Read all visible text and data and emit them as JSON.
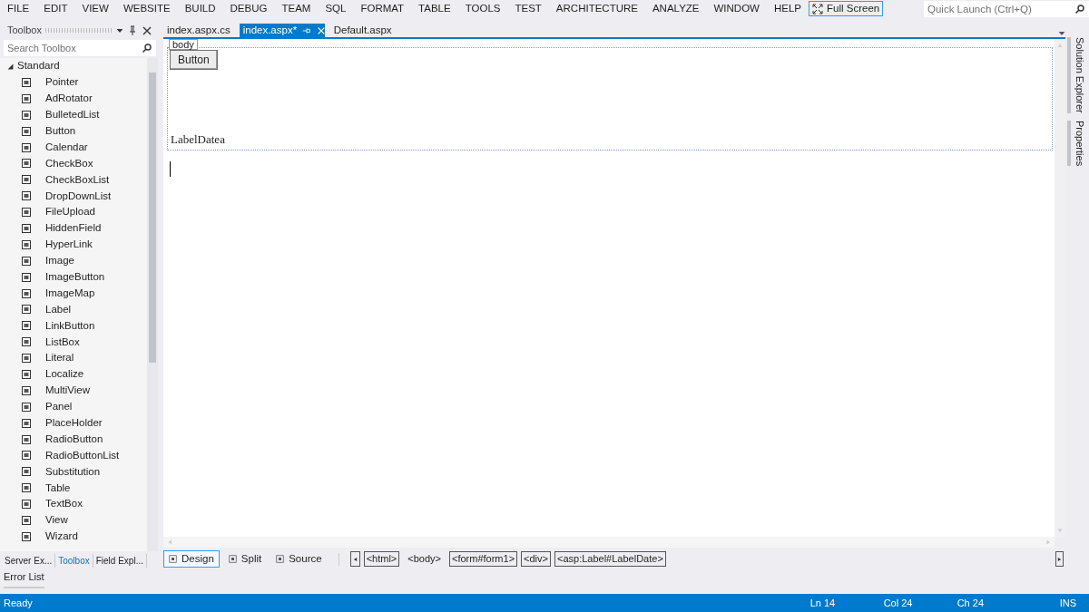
{
  "menu": [
    "FILE",
    "EDIT",
    "VIEW",
    "WEBSITE",
    "BUILD",
    "DEBUG",
    "TEAM",
    "SQL",
    "FORMAT",
    "TABLE",
    "TOOLS",
    "TEST",
    "ARCHITECTURE",
    "ANALYZE",
    "WINDOW",
    "HELP"
  ],
  "full_screen_button": "Full Screen",
  "quick_launch": {
    "placeholder": "Quick Launch (Ctrl+Q)"
  },
  "toolbox": {
    "title": "Toolbox",
    "search": {
      "placeholder": "Search Toolbox"
    },
    "group": {
      "label": "Standard",
      "expanded": true
    },
    "items": [
      "Pointer",
      "AdRotator",
      "BulletedList",
      "Button",
      "Calendar",
      "CheckBox",
      "CheckBoxList",
      "DropDownList",
      "FileUpload",
      "HiddenField",
      "HyperLink",
      "Image",
      "ImageButton",
      "ImageMap",
      "Label",
      "LinkButton",
      "ListBox",
      "Literal",
      "Localize",
      "MultiView",
      "Panel",
      "PlaceHolder",
      "RadioButton",
      "RadioButtonList",
      "Substitution",
      "Table",
      "TextBox",
      "View",
      "Wizard"
    ]
  },
  "toolbox_tabs": [
    {
      "label": "Server Ex...",
      "selected": false
    },
    {
      "label": "Toolbox",
      "selected": true
    },
    {
      "label": "Field Expl...",
      "selected": false
    }
  ],
  "doc_tabs": [
    {
      "label": "index.aspx.cs",
      "selected": false
    },
    {
      "label": "index.aspx*",
      "selected": true
    },
    {
      "label": "Default.aspx",
      "selected": false
    }
  ],
  "design": {
    "body_tag": "body",
    "button": "Button",
    "label": "LabelDatea"
  },
  "view_tabs": [
    {
      "label": "Design",
      "selected": true
    },
    {
      "label": "Split",
      "selected": false
    },
    {
      "label": "Source",
      "selected": false
    }
  ],
  "breadcrumbs": [
    {
      "label": "<html>",
      "boxed": true
    },
    {
      "label": "<body>",
      "boxed": false
    },
    {
      "label": "<form#form1>",
      "boxed": true
    },
    {
      "label": "<div>",
      "boxed": true
    },
    {
      "label": "<asp:Label#LabelDate>",
      "boxed": true
    }
  ],
  "side_tabs": [
    "Solution Explorer",
    "Properties"
  ],
  "error_list": "Error List",
  "status": {
    "text": "Ready",
    "ln": "Ln 14",
    "col": "Col 24",
    "ch": "Ch 24",
    "mode": "INS"
  }
}
